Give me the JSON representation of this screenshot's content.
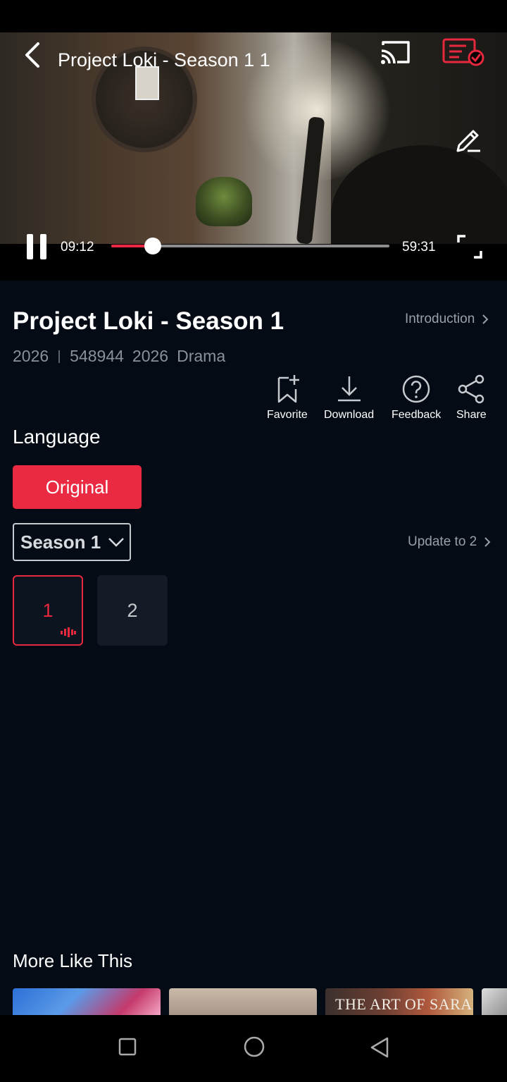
{
  "player": {
    "title": "Project Loki - Season 1 1",
    "current_time": "09:12",
    "total_time": "59:31",
    "progress_fraction": 0.15
  },
  "details": {
    "title": "Project Loki - Season 1",
    "intro_label": "Introduction",
    "meta": {
      "year": "2026",
      "views": "548944",
      "release_year": "2026",
      "genre": "Drama"
    }
  },
  "actions": [
    {
      "label": "Favorite",
      "icon": "bookmark-plus-icon"
    },
    {
      "label": "Download",
      "icon": "download-icon"
    },
    {
      "label": "Feedback",
      "icon": "question-icon"
    },
    {
      "label": "Share",
      "icon": "share-icon"
    }
  ],
  "language": {
    "label": "Language",
    "selected": "Original"
  },
  "season": {
    "selected": "Season 1",
    "update_label": "Update to 2"
  },
  "episodes": [
    {
      "number": "1",
      "active": true
    },
    {
      "number": "2",
      "active": false
    }
  ],
  "more_like_this": {
    "title": "More Like This",
    "thumb_texts": [
      "THE ART OF SARAH"
    ]
  },
  "colors": {
    "accent": "#e8283e",
    "background": "#050b15",
    "muted_text": "#9aa0a8"
  }
}
